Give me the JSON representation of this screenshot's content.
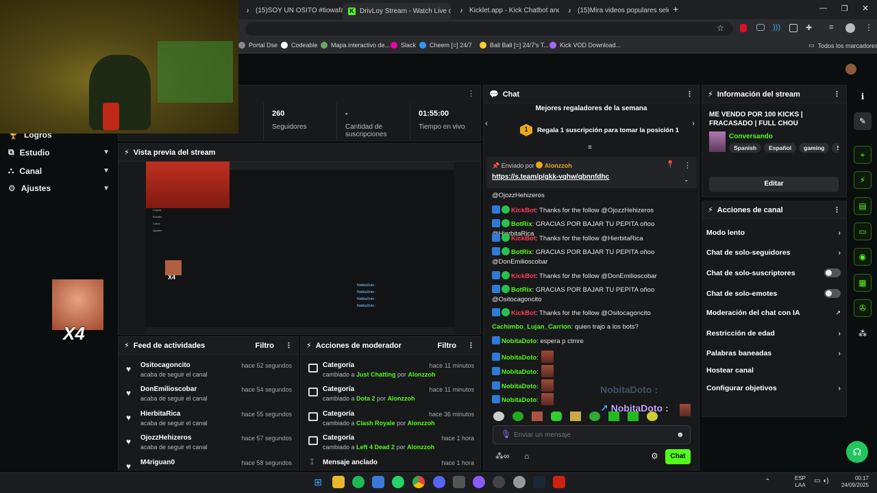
{
  "browser": {
    "tabs": [
      {
        "label": "(15)SOY UN OSITO #tiowafa #"
      },
      {
        "label": "DrivLoy Stream - Watch Live on"
      },
      {
        "label": "Kicklet.app - Kick Chatbot and"
      },
      {
        "label": "(15)Mira videos populares sele"
      }
    ],
    "bookmarks": [
      "Portal Dse",
      "Codeable",
      "Mapa interactivo de...",
      "Slack",
      "Cheem [=] 24/7",
      "Ball Ball [=] 24/7's T...",
      "Kick VOD Download..."
    ],
    "all_bookmarks": "Todos los marcadores"
  },
  "sidebar": {
    "items": [
      {
        "label": "Logros"
      },
      {
        "label": "Estudio"
      },
      {
        "label": "Canal"
      },
      {
        "label": "Ajustes"
      }
    ],
    "overlay_text": "X4"
  },
  "stats": [
    {
      "value": "",
      "label": "s"
    },
    {
      "value": "260",
      "label": "Seguidores"
    },
    {
      "value": "-",
      "label": "Cantidad de suscripciones"
    },
    {
      "value": "01:55:00",
      "label": "Tiempo en vivo"
    }
  ],
  "preview": {
    "title": "Vista previa del stream",
    "mini_x4": "X4",
    "mini_side": [
      "Logros",
      "Estudio",
      "Canal",
      "Ajustes"
    ],
    "mini_chat": [
      "NobitaDoto :",
      "NobitaDoto :",
      "NobitaDoto :",
      "NobitaDoto :"
    ]
  },
  "feed": {
    "title": "Feed de actividades",
    "filter": "Filtro",
    "rows": [
      {
        "name": "Ositocagoncito",
        "sub": "acaba de seguir el canal",
        "time": "hace 52 segundos"
      },
      {
        "name": "DonEmilioscobar",
        "sub": "acaba de seguir el canal",
        "time": "hace 54 segundos"
      },
      {
        "name": "HierbitaRica",
        "sub": "acaba de seguir el canal",
        "time": "hace 55 segundos"
      },
      {
        "name": "OjozzHehizeros",
        "sub": "acaba de seguir el canal",
        "time": "hace 57 segundos"
      },
      {
        "name": "M4riguan0",
        "sub": "",
        "time": "hace 58 segundos"
      }
    ]
  },
  "mod": {
    "title": "Acciones de moderador",
    "filter": "Filtro",
    "rows": [
      {
        "name": "Categoría",
        "pre": "cambiado a ",
        "cat": "Just Chatting",
        "mid": " por ",
        "by": "Alonzzoh",
        "time": "hace 11 minutos"
      },
      {
        "name": "Categoría",
        "pre": "cambiado a ",
        "cat": "Dota 2",
        "mid": " por ",
        "by": "Alonzzoh",
        "time": "hace 11 minutos"
      },
      {
        "name": "Categoría",
        "pre": "cambiado a ",
        "cat": "Clash Royale",
        "mid": " por ",
        "by": "Alonzzoh",
        "time": "hace 36 minutos"
      },
      {
        "name": "Categoría",
        "pre": "cambiado a ",
        "cat": "Left 4 Dead 2",
        "mid": " por ",
        "by": "Alonzzoh",
        "time": "hace 1 hora"
      },
      {
        "name": "Mensaje anclado",
        "pre": "",
        "cat": "",
        "mid": "",
        "by": "",
        "time": "hace 1 hora"
      }
    ]
  },
  "chat": {
    "title": "Chat",
    "gifters_title": "Mejores regaladores de la semana",
    "gifters_cta": "Regala 1 suscripción para tomar la posición 1",
    "rank": "1",
    "pinned_by_label": "Enviado por",
    "pinned_by": "Alonzzoh",
    "pinned_link": "https://s.team/p/gkk-vqhw/qbnnfdhc",
    "first_line": "@OjozzHehizeros",
    "messages": [
      {
        "user": "KickBot",
        "color": "#ff3b55",
        "text": ": Thanks for the follow @OjozzHehizeros"
      },
      {
        "user": "BotRix",
        "color": "#53fc18",
        "text": ": GRACIAS POR BAJAR TU PEPITA oñoo @HierbitaRica"
      },
      {
        "user": "KickBot",
        "color": "#ff3b55",
        "text": ": Thanks for the follow @HierbitaRica"
      },
      {
        "user": "BotRix",
        "color": "#53fc18",
        "text": ": GRACIAS POR BAJAR TU PEPITA oñoo @DonEmilioscobar"
      },
      {
        "user": "KickBot",
        "color": "#ff3b55",
        "text": ": Thanks for the follow @DonEmilioscobar"
      },
      {
        "user": "BotRix",
        "color": "#53fc18",
        "text": ": GRACIAS POR BAJAR TU PEPITA oñoo @Ositocagoncito"
      },
      {
        "user": "KickBot",
        "color": "#ff3b55",
        "text": ": Thanks for the follow @Ositocagoncito"
      },
      {
        "user": "Cachimbo_Lujan_Carrion",
        "color": "#53fc18",
        "text": ": quien trajo a los bots?"
      },
      {
        "user": "NobitaDoto",
        "color": "#53fc18",
        "text": ": espera p ctmre"
      },
      {
        "user": "NobitaDoto",
        "color": "#53fc18",
        "text": ":"
      },
      {
        "user": "NobitaDoto",
        "color": "#53fc18",
        "text": ":"
      },
      {
        "user": "NobitaDoto",
        "color": "#53fc18",
        "text": ":"
      },
      {
        "user": "NobitaDoto",
        "color": "#53fc18",
        "text": ":"
      }
    ],
    "overlay_user": "NobitaDoto :",
    "overlay_user_ghost": "NobitaDoto :",
    "input_placeholder": "Enviar un mensaje",
    "send_label": "Chat"
  },
  "info": {
    "title": "Información del stream",
    "stream_title": "ME VENDO POR 100 KICKS | FRACASADO | FULL CHOU",
    "category": "Conversando",
    "tags": [
      "Spanish",
      "Español",
      "gaming",
      "Shoo"
    ],
    "edit_label": "Editar"
  },
  "actions": {
    "title": "Acciones de canal",
    "items": [
      {
        "label": "Modo lento",
        "kind": "chev"
      },
      {
        "label": "Chat de solo-seguidores",
        "kind": "chev"
      },
      {
        "label": "Chat de solo-suscriptores",
        "kind": "toggle"
      },
      {
        "label": "Chat de solo-emotes",
        "kind": "toggle"
      },
      {
        "label": "Moderación del chat con IA",
        "kind": "ext"
      },
      {
        "label": "Restricción de edad",
        "kind": "chev"
      },
      {
        "label": "Palabras baneadas",
        "kind": "chev"
      },
      {
        "label": "Hostear canal",
        "kind": "none"
      },
      {
        "label": "Configurar objetivos",
        "kind": "chev"
      }
    ]
  },
  "taskbar": {
    "lang": "ESP",
    "lang2": "LAA",
    "time": "00:17",
    "date": "24/09/2025"
  },
  "colors": {
    "accent": "#53fc18",
    "kickbot": "#ff3b55"
  }
}
